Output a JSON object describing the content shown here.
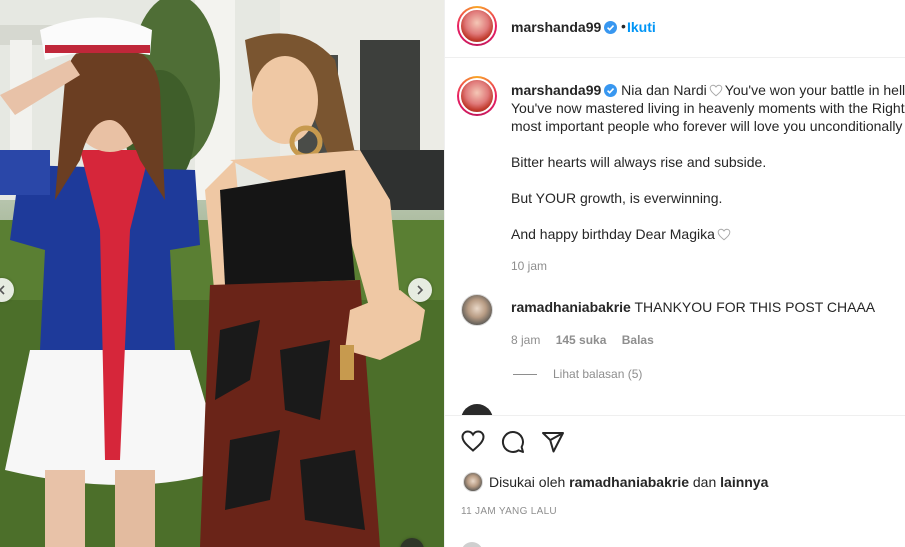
{
  "post": {
    "username": "marshanda99",
    "follow_label": "Ikuti",
    "dot": "•",
    "caption_lines": [
      "Nia dan Nardi",
      "You've won your battle in hell.",
      "You've now mastered living in heavenly moments with the Right",
      "most important people who forever will love you unconditionally"
    ],
    "paragraph_2": "Bitter hearts will always rise and subside.",
    "paragraph_3": "But YOUR growth, is everwinning.",
    "paragraph_4": "And happy birthday Dear Magika",
    "caption_time": "10 jam"
  },
  "comment": {
    "username": "ramadhaniabakrie",
    "text": "THANKYOU FOR THIS POST CHAAA",
    "time": "8 jam",
    "likes": "145 suka",
    "reply_label": "Balas",
    "view_replies": "Lihat balasan (5)"
  },
  "actions": {
    "liked_prefix": "Disukai oleh",
    "liked_user": "ramadhaniabakrie",
    "liked_and": "dan",
    "liked_others": "lainnya",
    "timestamp": "11 JAM YANG LALU"
  },
  "icons": [
    "heart-icon",
    "comment-icon",
    "share-icon",
    "verified-icon",
    "chevron-right-icon",
    "chevron-left-icon"
  ],
  "colors": {
    "link_blue": "#0095f6",
    "verified_blue": "#3897f0",
    "muted": "#8e8e8e",
    "text": "#262626"
  }
}
